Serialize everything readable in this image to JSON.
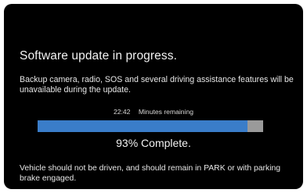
{
  "update": {
    "title": "Software update in progress.",
    "description": "Backup camera, radio, SOS and several driving assistance features will be unavailable during the update.",
    "time_remaining": "22:42",
    "time_label": "Minutes remaining",
    "progress_fraction": 0.93,
    "percent_text": "93% Complete.",
    "warning": "Vehicle should not be driven, and should remain in PARK or with parking brake engaged."
  },
  "colors": {
    "background": "#000000",
    "progress_fill": "#3a7dc9",
    "progress_track": "#9a9a9a"
  }
}
